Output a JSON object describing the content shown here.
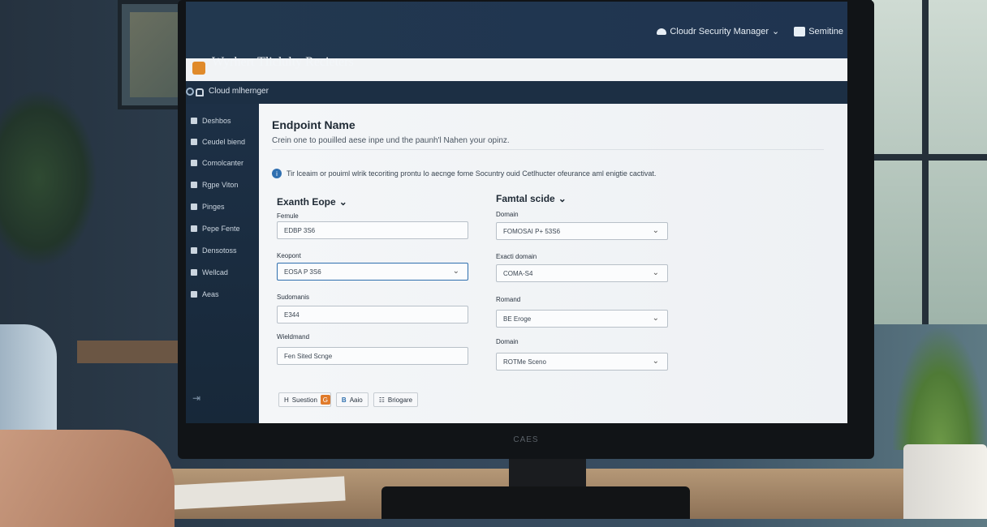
{
  "app": {
    "title": "Wyrhert Tliclulty Recieters",
    "subtitle": "Cloud mlhernger"
  },
  "topbar": {
    "account_label": "Cloudr Security Manager",
    "menu_label": "Semitine"
  },
  "sidebar": {
    "items": [
      {
        "label": "Deshbos",
        "icon": "grid-icon"
      },
      {
        "label": "Ceudel biend",
        "icon": "copy-icon"
      },
      {
        "label": "Comolcanter",
        "icon": "square-icon"
      },
      {
        "label": "Rgpe Viton",
        "icon": "file-icon"
      },
      {
        "label": "Pinges",
        "icon": "file-icon"
      },
      {
        "label": "Pepe Fente",
        "icon": "page-icon"
      },
      {
        "label": "Densotoss",
        "icon": "image-icon"
      },
      {
        "label": "Wellcad",
        "icon": "location-pin-icon"
      },
      {
        "label": "Aeas",
        "icon": "users-icon"
      }
    ]
  },
  "main": {
    "title": "Endpoint Name",
    "description": "Crein one to pouilled aese inpe und the paunh'l Nahen your opinz.",
    "info_text": "Tir lceaim or pouiml wlrik tecoriting prontu Io aecnge fome Socuntry ouid Cetlhucter ofeurance aml enigtie cactivat."
  },
  "left_column": {
    "title": "Exanth Eope",
    "fields": [
      {
        "label": "Femule",
        "value": "EDBP 3S6",
        "active": false,
        "has_dropdown": false
      },
      {
        "label": "Keopont",
        "value": "EOSA P 3S6",
        "active": true,
        "has_dropdown": true
      },
      {
        "label": "Sudomanis",
        "value": "E344",
        "active": false,
        "has_dropdown": false
      },
      {
        "label": "Wieldmand",
        "value": "Fen Sited Scnge",
        "active": false,
        "has_dropdown": false
      }
    ]
  },
  "right_column": {
    "title": "Famtal scide",
    "fields": [
      {
        "label": "Domain",
        "value": "FOMOSAI P+ 53S6",
        "active": false,
        "has_dropdown": true
      },
      {
        "label": "Exacti domain",
        "value": "COMA-S4",
        "active": false,
        "has_dropdown": true
      },
      {
        "label": "Romand",
        "value": "BE Eroge",
        "active": false,
        "has_dropdown": true
      },
      {
        "label": "Domain",
        "value": "ROTMe Sceno",
        "active": false,
        "has_dropdown": true
      }
    ]
  },
  "buttons": [
    {
      "label": "Suestion",
      "icon": "h-icon",
      "badge": "G"
    },
    {
      "label": "Aaio",
      "icon": "b-icon",
      "badge": ""
    },
    {
      "label": "Briogare",
      "icon": "list-icon",
      "badge": ""
    }
  ],
  "monitor": {
    "brand": "CAES"
  },
  "colors": {
    "topbar": "#22384f",
    "sidebar": "#1d3046",
    "accent": "#2e6fae",
    "badge": "#e07a2a"
  }
}
